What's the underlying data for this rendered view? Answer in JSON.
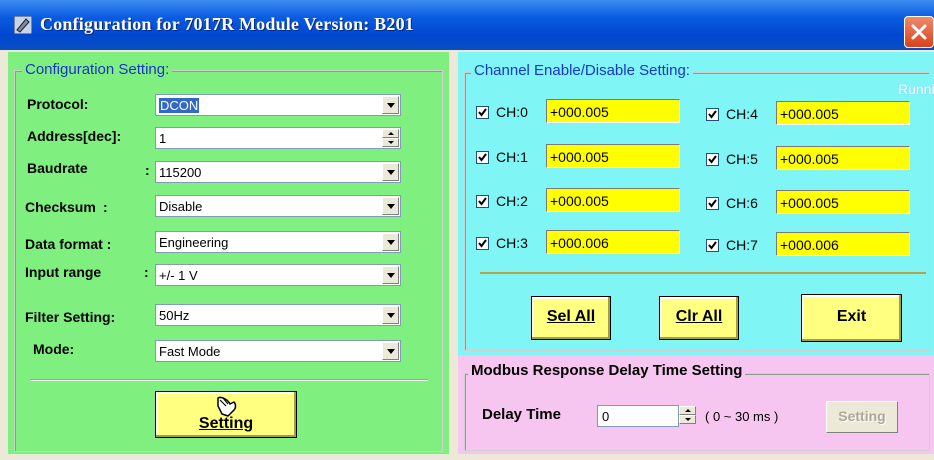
{
  "window": {
    "title": "Configuration for 7017R Module Version: B201",
    "icon": "pen-icon",
    "close_icon": "close-icon",
    "accent": "#0a5be0",
    "close_color": "#d9421c"
  },
  "config": {
    "legend": "Configuration Setting:",
    "protocol": {
      "label": "Protocol:",
      "value": "DCON"
    },
    "address": {
      "label": "Address[dec]:",
      "value": "1"
    },
    "baudrate": {
      "label": "Baudrate",
      "colon": ":",
      "value": "115200"
    },
    "checksum": {
      "label": "Checksum",
      "colon": ":",
      "value": "Disable"
    },
    "data_format": {
      "label": "Data format :",
      "value": "Engineering"
    },
    "input_range": {
      "label": "Input range",
      "colon": ":",
      "value": "+/- 1 V"
    },
    "filter": {
      "label": "Filter Setting:",
      "value": "50Hz"
    },
    "mode": {
      "label": "Mode:",
      "value": "Fast Mode"
    },
    "setting_button": "Setting",
    "panel_color": "#7ff07f"
  },
  "channels": {
    "legend": "Channel Enable/Disable Setting:",
    "status": "Running !",
    "items": [
      {
        "label": "CH:0",
        "checked": true,
        "value": "+000.005"
      },
      {
        "label": "CH:1",
        "checked": true,
        "value": "+000.005"
      },
      {
        "label": "CH:2",
        "checked": true,
        "value": "+000.005"
      },
      {
        "label": "CH:3",
        "checked": true,
        "value": "+000.006"
      },
      {
        "label": "CH:4",
        "checked": true,
        "value": "+000.005"
      },
      {
        "label": "CH:5",
        "checked": true,
        "value": "+000.005"
      },
      {
        "label": "CH:6",
        "checked": true,
        "value": "+000.005"
      },
      {
        "label": "CH:7",
        "checked": true,
        "value": "+000.006"
      }
    ],
    "buttons": {
      "sel_all": "Sel All",
      "clr_all": "Clr All",
      "exit": "Exit"
    },
    "panel_color": "#7ff5f5",
    "value_color": "#ffff00"
  },
  "modbus": {
    "legend": "Modbus Response Delay Time Setting",
    "delay_label": "Delay Time",
    "delay_value": "0",
    "range_text": "( 0 ~ 30 ms )",
    "setting_button": "Setting",
    "panel_color": "#f7c6f0"
  }
}
